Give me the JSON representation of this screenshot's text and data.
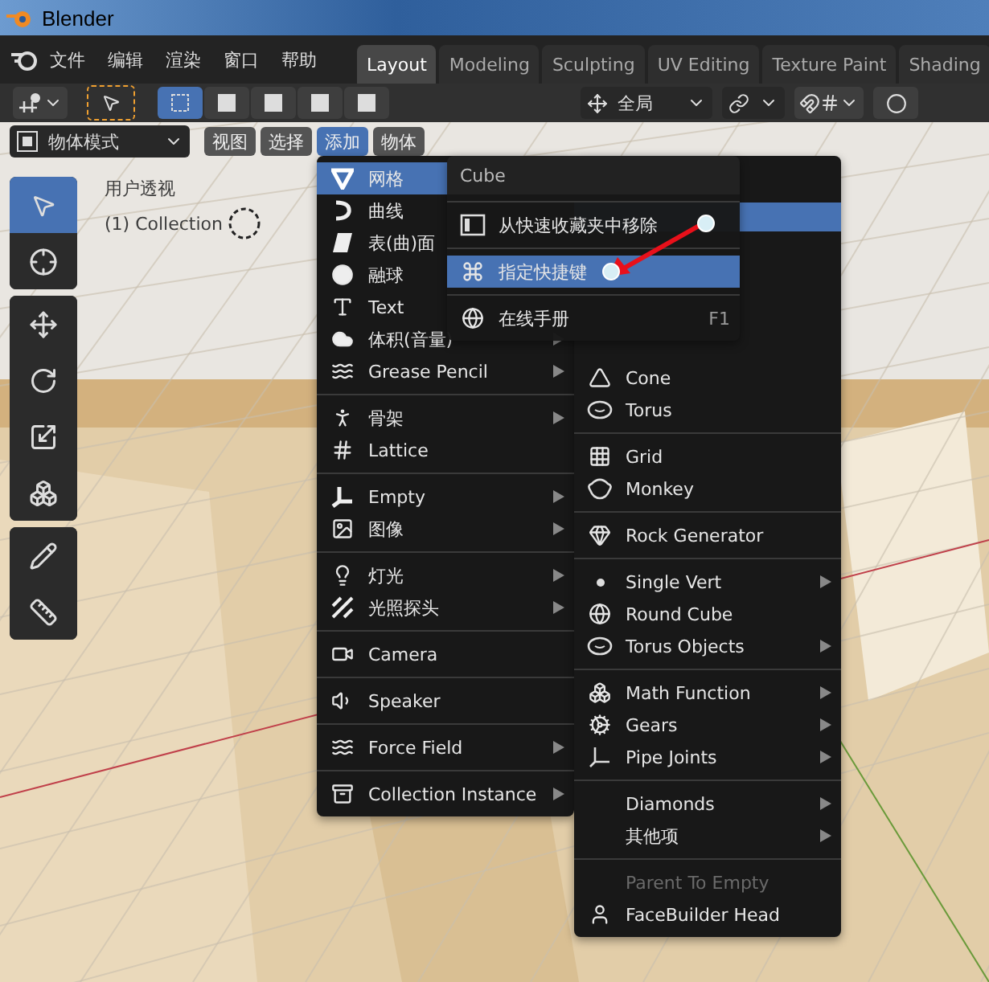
{
  "window": {
    "title": "Blender"
  },
  "menubar": [
    "文件",
    "编辑",
    "渲染",
    "窗口",
    "帮助"
  ],
  "workspace_tabs": [
    {
      "label": "Layout",
      "selected": true
    },
    {
      "label": "Modeling",
      "selected": false
    },
    {
      "label": "Sculpting",
      "selected": false
    },
    {
      "label": "UV Editing",
      "selected": false
    },
    {
      "label": "Texture Paint",
      "selected": false
    },
    {
      "label": "Shading",
      "selected": false
    }
  ],
  "tool_header": {
    "transform_orientation": "全局"
  },
  "viewport_header": {
    "mode": "物体模式",
    "menus": [
      {
        "label": "视图",
        "selected": false
      },
      {
        "label": "选择",
        "selected": false
      },
      {
        "label": "添加",
        "selected": true
      },
      {
        "label": "物体",
        "selected": false
      }
    ]
  },
  "toolbar": [
    {
      "selected": true
    },
    {
      "selected": false
    },
    {
      "selected": false
    },
    {
      "selected": false
    },
    {
      "selected": false
    },
    {
      "selected": false
    },
    {
      "selected": false
    },
    {
      "selected": false
    }
  ],
  "viewport_overlay": {
    "view_name": "用户透视",
    "collection": "(1) Collection"
  },
  "add_menu": {
    "groups": [
      {
        "items": [
          {
            "label": "网格",
            "selected": true
          },
          {
            "label": "曲线",
            "selected": false
          },
          {
            "label": "表(曲)面",
            "selected": false
          },
          {
            "label": "融球",
            "selected": false
          },
          {
            "label": "Text",
            "selected": false
          },
          {
            "label": "体积(音量)",
            "selected": false,
            "submenu": true
          },
          {
            "label": "Grease Pencil",
            "selected": false,
            "submenu": true
          }
        ]
      },
      {
        "items": [
          {
            "label": "骨架",
            "selected": false,
            "submenu": true
          },
          {
            "label": "Lattice",
            "selected": false,
            "submenu": false
          }
        ]
      },
      {
        "items": [
          {
            "label": "Empty",
            "selected": false,
            "submenu": true
          },
          {
            "label": "图像",
            "selected": false,
            "submenu": true
          }
        ]
      },
      {
        "items": [
          {
            "label": "灯光",
            "selected": false,
            "submenu": true
          },
          {
            "label": "光照探头",
            "selected": false,
            "submenu": true
          }
        ]
      },
      {
        "items": [
          {
            "label": "Camera",
            "selected": false,
            "submenu": false
          }
        ]
      },
      {
        "items": [
          {
            "label": "Speaker",
            "selected": false,
            "submenu": false
          }
        ]
      },
      {
        "items": [
          {
            "label": "Force Field",
            "selected": false,
            "submenu": true
          }
        ]
      },
      {
        "items": [
          {
            "label": "Collection Instance",
            "selected": false,
            "submenu": true
          }
        ]
      }
    ]
  },
  "mesh_submenu": {
    "covered_highlight": true,
    "groups": [
      {
        "items": [
          {
            "label": "Cone",
            "disabled": false,
            "submenu": false
          },
          {
            "label": "Torus",
            "disabled": false,
            "submenu": false
          }
        ]
      },
      {
        "items": [
          {
            "label": "Grid",
            "disabled": false,
            "submenu": false
          },
          {
            "label": "Monkey",
            "disabled": false,
            "submenu": false
          }
        ]
      },
      {
        "items": [
          {
            "label": "Rock Generator",
            "disabled": false,
            "submenu": false
          }
        ]
      },
      {
        "items": [
          {
            "label": "Single Vert",
            "disabled": false,
            "submenu": true
          },
          {
            "label": "Round Cube",
            "disabled": false,
            "submenu": false
          },
          {
            "label": "Torus Objects",
            "disabled": false,
            "submenu": true
          }
        ]
      },
      {
        "items": [
          {
            "label": "Math Function",
            "disabled": false,
            "submenu": true
          },
          {
            "label": "Gears",
            "disabled": false,
            "submenu": true
          },
          {
            "label": "Pipe Joints",
            "disabled": false,
            "submenu": true
          }
        ]
      },
      {
        "items": [
          {
            "label": "Diamonds",
            "disabled": false,
            "submenu": true
          },
          {
            "label": "其他项",
            "disabled": false,
            "submenu": true
          }
        ]
      },
      {
        "items": [
          {
            "label": "Parent To Empty",
            "disabled": true,
            "submenu": false
          },
          {
            "label": "FaceBuilder Head",
            "disabled": false,
            "submenu": false
          }
        ]
      }
    ]
  },
  "context_menu": {
    "title": "Cube",
    "items": [
      {
        "label": "从快速收藏夹中移除",
        "selected": false
      },
      {
        "label": "指定快捷键",
        "selected": true
      },
      {
        "label": "在线手册",
        "selected": false,
        "shortcut": "F1"
      }
    ]
  }
}
